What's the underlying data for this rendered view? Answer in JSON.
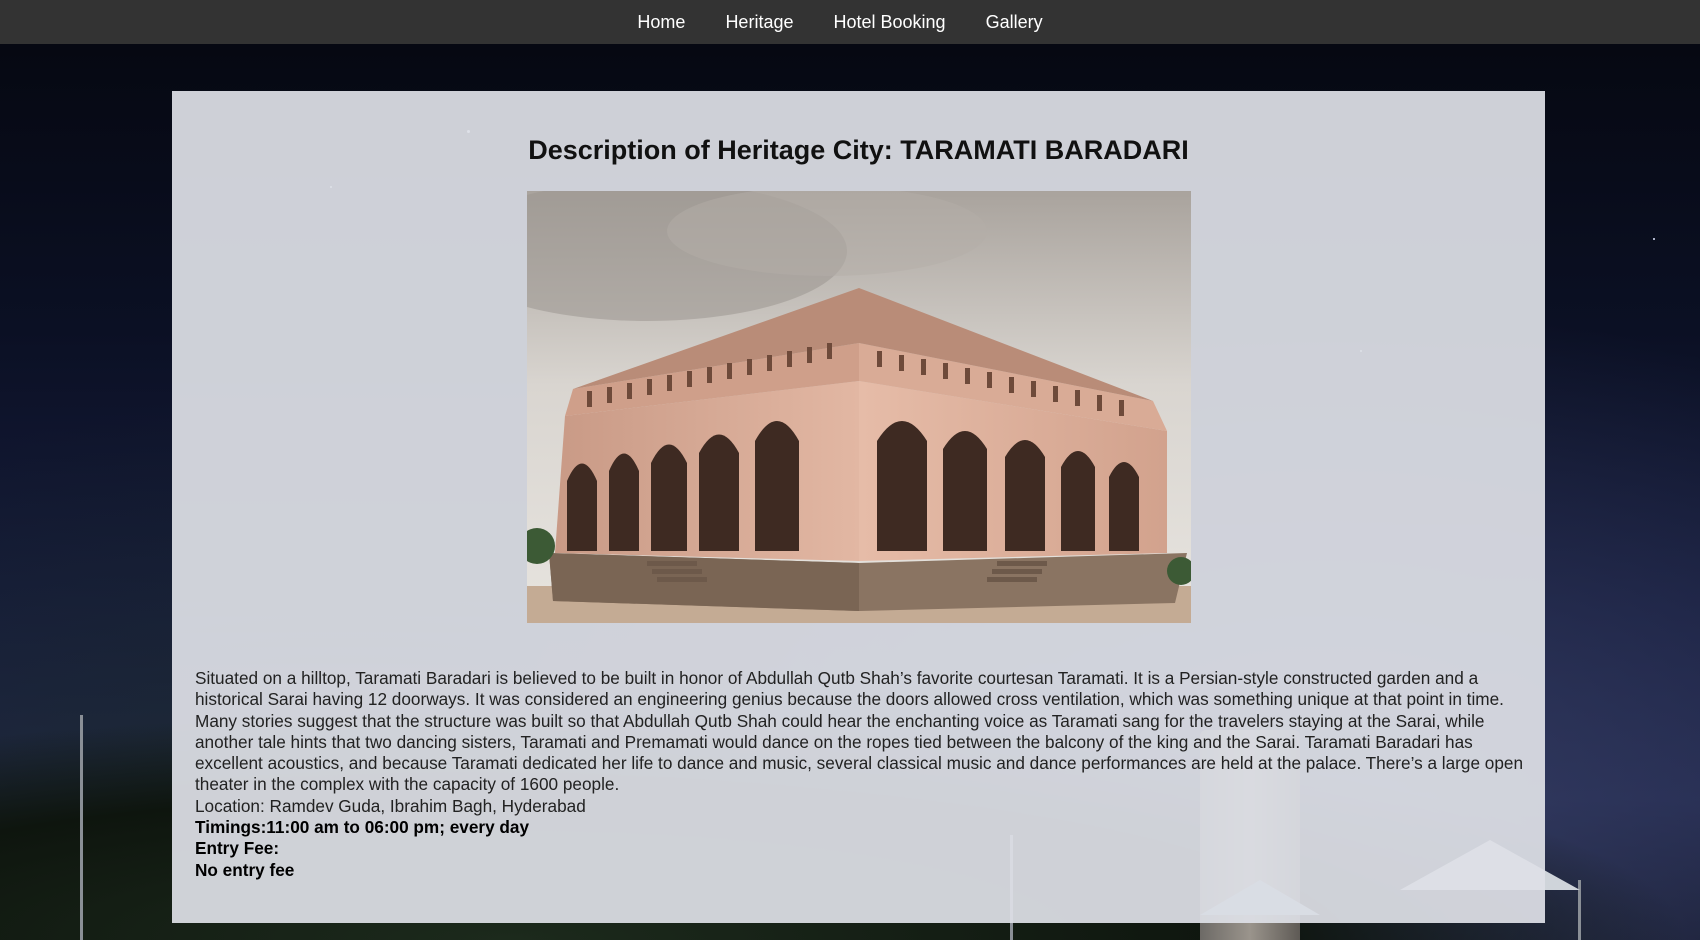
{
  "nav": {
    "items": [
      {
        "label": "Home"
      },
      {
        "label": "Heritage"
      },
      {
        "label": "Hotel Booking"
      },
      {
        "label": "Gallery"
      }
    ]
  },
  "page": {
    "title": "Description of Heritage City: TARAMATI BARADARI",
    "image_subject": "Taramati Baradari pavilion photo",
    "description": "Situated on a hilltop, Taramati Baradari is believed to be built in honor of Abdullah Qutb Shah’s favorite courtesan Taramati. It is a Persian-style constructed garden and a historical Sarai having 12 doorways. It was considered an engineering genius because the doors allowed cross ventilation, which was something unique at that point in time. Many stories suggest that the structure was built so that Abdullah Qutb Shah could hear the enchanting voice as Taramati sang for the travelers staying at the Sarai, while another tale hints that two dancing sisters, Taramati and Premamati would dance on the ropes tied between the balcony of the king and the Sarai. Taramati Baradari has excellent acoustics, and because Taramati dedicated her life to dance and music, several classical music and dance performances are held at the palace. There’s a large open theater in the complex with the capacity of 1600 people.",
    "location": "Location: Ramdev Guda, Ibrahim Bagh, Hyderabad",
    "timings": "Timings:11:00 am to 06:00 pm; every day",
    "entry_fee_label": "Entry Fee:",
    "entry_fee_value": "No entry fee"
  },
  "colors": {
    "navbar_bg": "#333333",
    "nav_text": "#ffffff",
    "panel_bg": "#dee0e6"
  }
}
